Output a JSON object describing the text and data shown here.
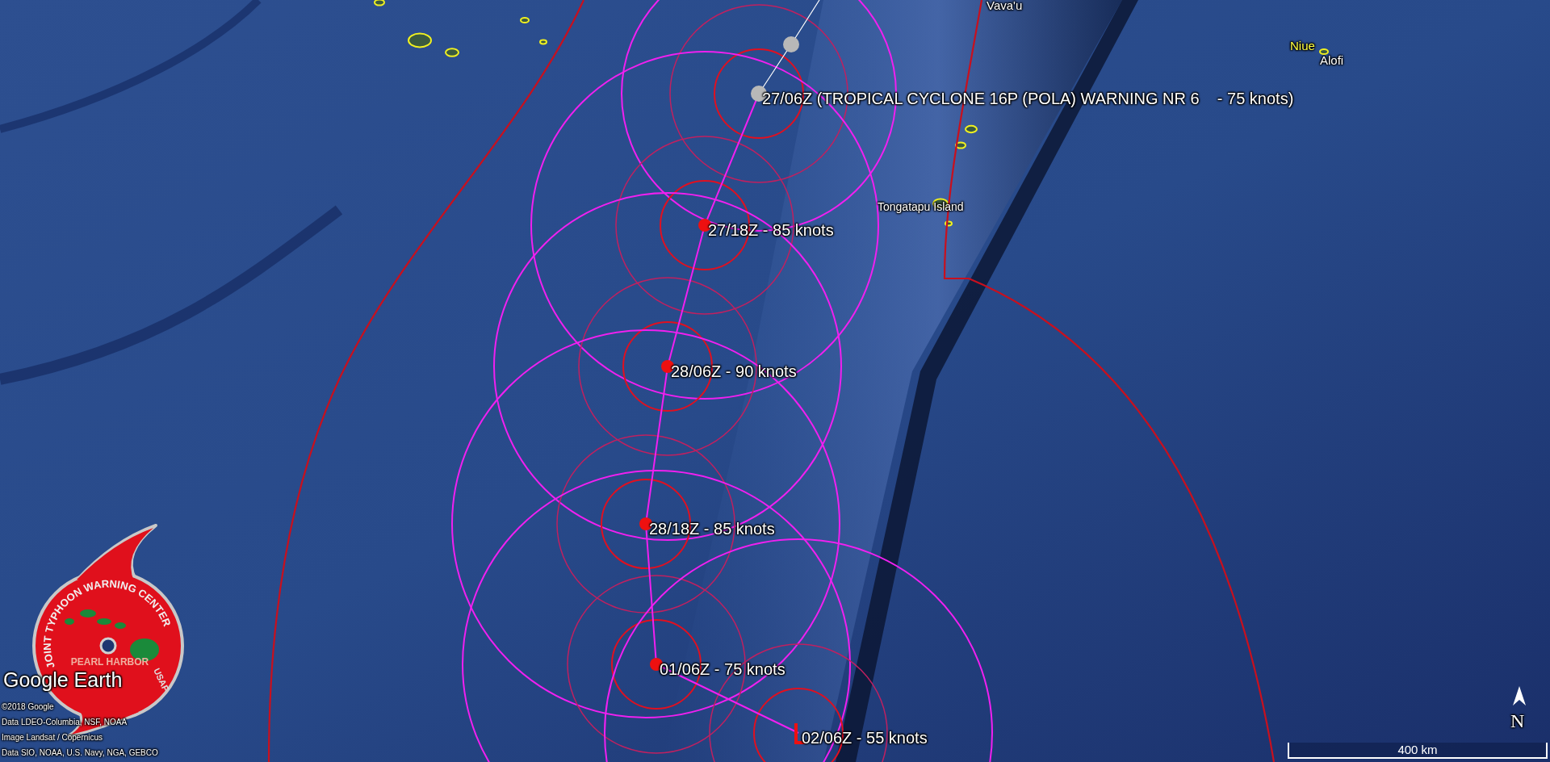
{
  "map": {
    "places": [
      {
        "name": "Vava'u",
        "kind": "town"
      },
      {
        "name": "Niue",
        "kind": "island"
      },
      {
        "name": "Alofi",
        "kind": "town"
      },
      {
        "name": "Tongatapu Island",
        "kind": "island"
      }
    ],
    "track": [
      {
        "kind": "past"
      },
      {
        "kind": "past",
        "label": "27/06Z (TROPICAL CYCLONE 16P (POLA) WARNING NR 6    - 75 knots)"
      },
      {
        "kind": "forecast",
        "label": "27/18Z - 85 knots"
      },
      {
        "kind": "forecast",
        "label": "28/06Z - 90 knots"
      },
      {
        "kind": "forecast",
        "label": "28/18Z - 85 knots"
      },
      {
        "kind": "forecast",
        "label": "01/06Z - 75 knots"
      },
      {
        "kind": "low",
        "label": "02/06Z - 55 knots"
      }
    ]
  },
  "logo": {
    "top_text": "JOINT TYPHOON WARNING CENTER",
    "middle_text": "PEARL HARBOR",
    "side_text": "USAF"
  },
  "branding": "Google Earth",
  "credits": [
    "©2018 Google",
    "Data LDEO-Columbia, NSF, NOAA",
    "Image Landsat / Copernicus",
    "Data SIO, NOAA, U.S. Navy, NGA, GEBCO"
  ],
  "scale": {
    "label": "400 km"
  },
  "compass": {
    "label": "N"
  }
}
